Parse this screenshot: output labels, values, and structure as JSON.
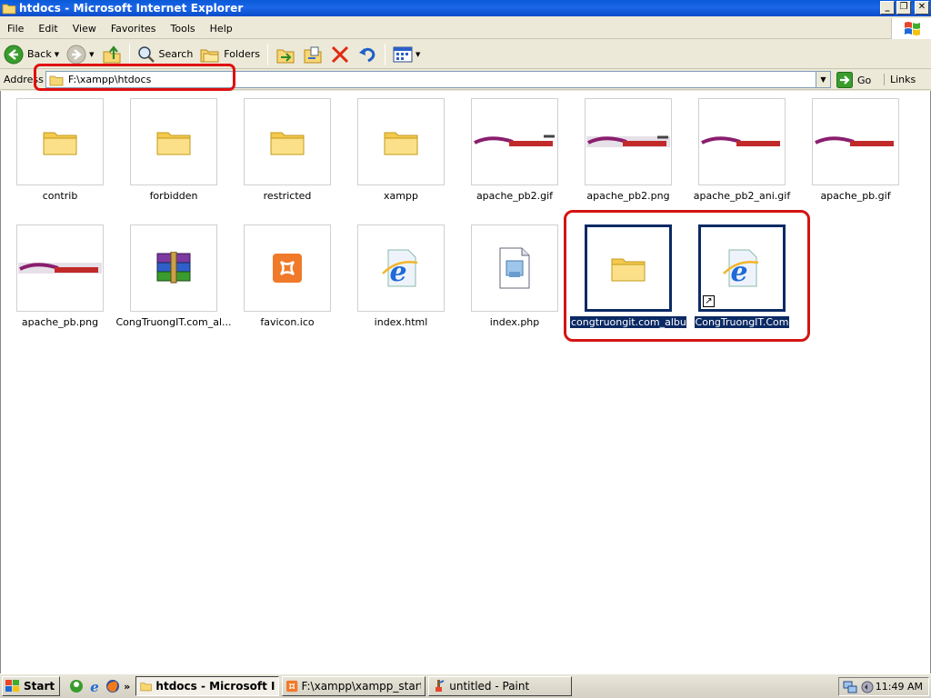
{
  "window": {
    "title": "htdocs - Microsoft Internet Explorer"
  },
  "menu": {
    "items": [
      "File",
      "Edit",
      "View",
      "Favorites",
      "Tools",
      "Help"
    ]
  },
  "toolbar": {
    "back_label": "Back",
    "search_label": "Search",
    "folders_label": "Folders"
  },
  "address": {
    "label": "Address",
    "path": "F:\\xampp\\htdocs",
    "go_label": "Go",
    "links_label": "Links"
  },
  "files": [
    {
      "name": "contrib",
      "type": "folder"
    },
    {
      "name": "forbidden",
      "type": "folder"
    },
    {
      "name": "restricted",
      "type": "folder"
    },
    {
      "name": "xampp",
      "type": "folder"
    },
    {
      "name": "apache_pb2.gif",
      "type": "apache"
    },
    {
      "name": "apache_pb2.png",
      "type": "apache"
    },
    {
      "name": "apache_pb2_ani.gif",
      "type": "apache"
    },
    {
      "name": "apache_pb.gif",
      "type": "apache"
    },
    {
      "name": "apache_pb.png",
      "type": "apache"
    },
    {
      "name": "CongTruongIT.com_al...",
      "type": "rar"
    },
    {
      "name": "favicon.ico",
      "type": "xampp"
    },
    {
      "name": "index.html",
      "type": "ie"
    },
    {
      "name": "index.php",
      "type": "php"
    },
    {
      "name": "congtruongit.com_album",
      "type": "folder",
      "selected": true
    },
    {
      "name": "CongTruongIT.Com",
      "type": "ie-shortcut",
      "selected": true
    }
  ],
  "taskbar": {
    "start_label": "Start",
    "tasks": [
      "htdocs - Microsoft Int...",
      "F:\\xampp\\xampp_start....",
      "untitled - Paint"
    ],
    "clock": "11:49 AM"
  },
  "colors": {
    "title_blue": "#0a5ad8",
    "selection": "#0b2a64",
    "highlight_red": "#e01010"
  }
}
